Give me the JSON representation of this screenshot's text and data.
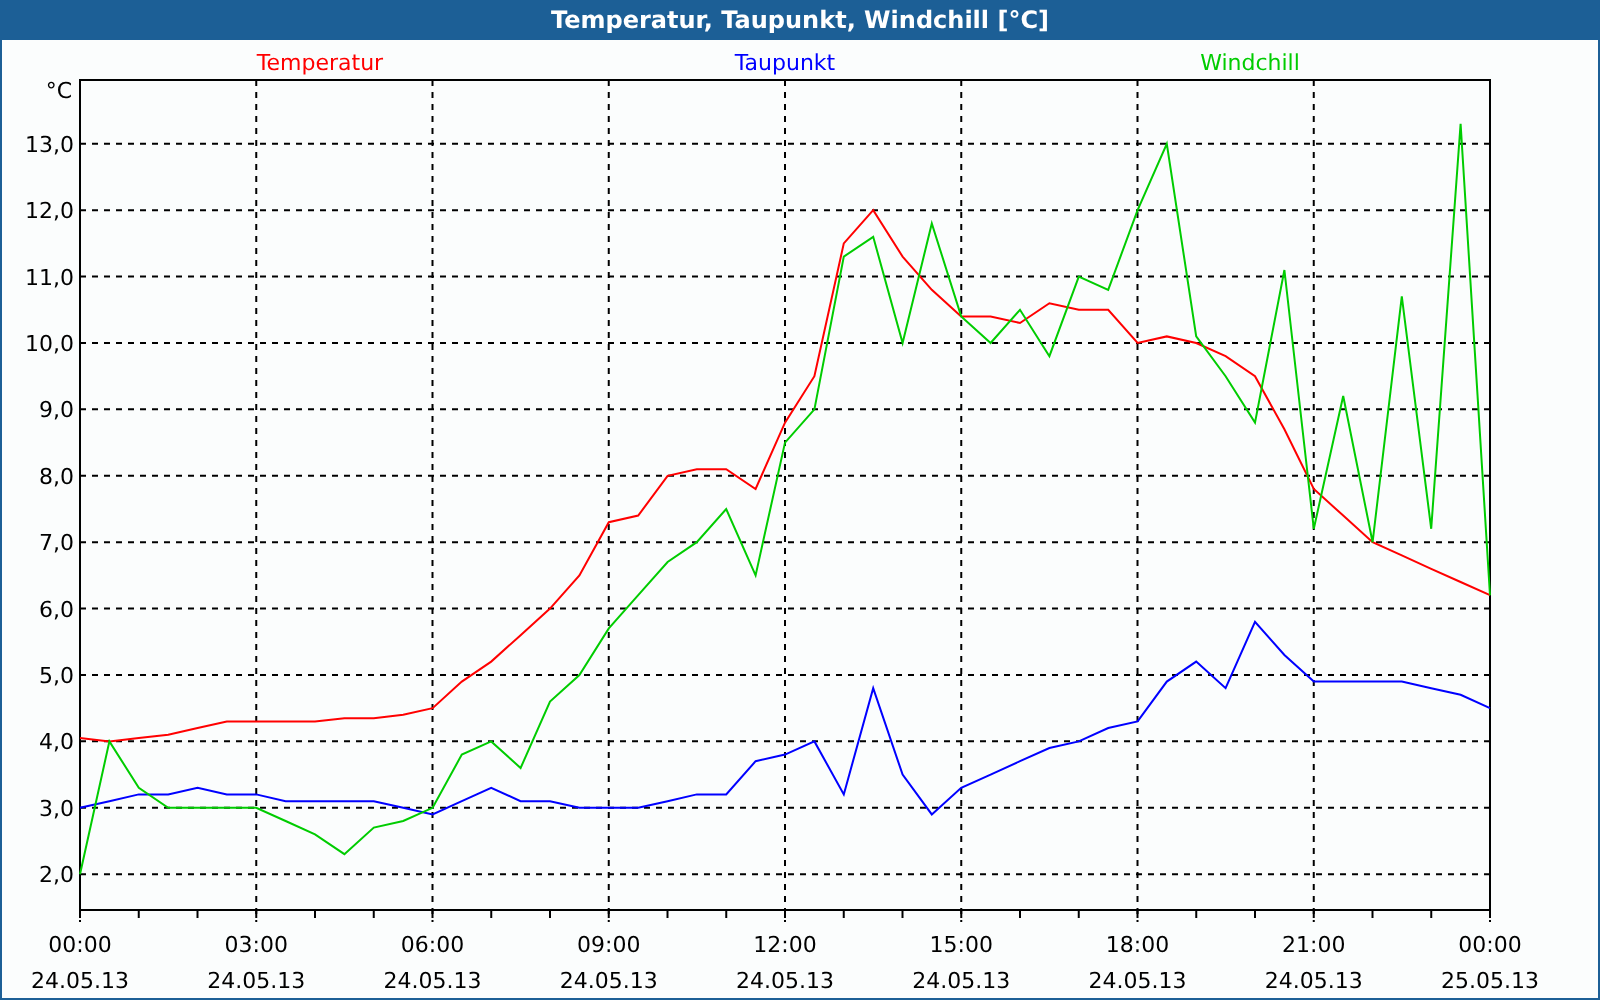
{
  "window": {
    "title": "Temperatur, Taupunkt, Windchill [°C]"
  },
  "chart_data": {
    "type": "line",
    "grid": true,
    "ylabel": "°C",
    "ylim": [
      1.46,
      13.96
    ],
    "categories": [
      "00:00\n24.05.13",
      null,
      null,
      null,
      null,
      null,
      "03:00\n24.05.13",
      null,
      null,
      null,
      null,
      null,
      "06:00\n24.05.13",
      null,
      null,
      null,
      null,
      null,
      "09:00\n24.05.13",
      null,
      null,
      null,
      null,
      null,
      "12:00\n24.05.13",
      null,
      null,
      null,
      null,
      null,
      "15:00\n24.05.13",
      null,
      null,
      null,
      null,
      null,
      "18:00\n24.05.13",
      null,
      null,
      null,
      null,
      null,
      "21:00\n24.05.13",
      null,
      null,
      null,
      null,
      null,
      "00:00\n25.05.13"
    ],
    "yticks": [
      {
        "value": 2,
        "label": "2,0"
      },
      {
        "value": 3,
        "label": "3,0"
      },
      {
        "value": 4,
        "label": "4,0"
      },
      {
        "value": 5,
        "label": "5,0"
      },
      {
        "value": 6,
        "label": "6,0"
      },
      {
        "value": 7,
        "label": "7,0"
      },
      {
        "value": 8,
        "label": "8,0"
      },
      {
        "value": 9,
        "label": "9,0"
      },
      {
        "value": 10,
        "label": "10,0"
      },
      {
        "value": 11,
        "label": "11,0"
      },
      {
        "value": 12,
        "label": "12,0"
      },
      {
        "value": 13,
        "label": "13,0"
      }
    ],
    "series": [
      {
        "name": "Temperatur",
        "color": "#ff0000",
        "values": [
          4.05,
          4.0,
          4.05,
          4.1,
          4.2,
          4.3,
          4.3,
          4.3,
          4.3,
          4.35,
          4.35,
          4.4,
          4.5,
          4.9,
          5.2,
          5.6,
          6.0,
          6.5,
          7.3,
          7.4,
          8.0,
          8.1,
          8.1,
          7.8,
          8.8,
          9.5,
          11.5,
          12.0,
          11.3,
          10.8,
          10.4,
          10.4,
          10.3,
          10.6,
          10.5,
          10.5,
          10.0,
          10.1,
          10.0,
          9.8,
          9.5,
          8.7,
          7.8,
          7.4,
          7.0,
          6.8,
          6.6,
          6.4,
          6.2
        ]
      },
      {
        "name": "Taupunkt",
        "color": "#0000ff",
        "values": [
          3.0,
          3.1,
          3.2,
          3.2,
          3.3,
          3.2,
          3.2,
          3.1,
          3.1,
          3.1,
          3.1,
          3.0,
          2.9,
          3.1,
          3.3,
          3.1,
          3.1,
          3.0,
          3.0,
          3.0,
          3.1,
          3.2,
          3.2,
          3.7,
          3.8,
          4.0,
          3.2,
          4.8,
          3.5,
          2.9,
          3.3,
          3.5,
          3.7,
          3.9,
          4.0,
          4.2,
          4.3,
          4.9,
          5.2,
          4.8,
          5.8,
          5.3,
          4.9,
          4.9,
          4.9,
          4.9,
          4.8,
          4.7,
          4.5
        ]
      },
      {
        "name": "Windchill",
        "color": "#00cc00",
        "values": [
          2.0,
          4.0,
          3.3,
          3.0,
          3.0,
          3.0,
          3.0,
          2.8,
          2.6,
          2.3,
          2.7,
          2.8,
          3.0,
          3.8,
          4.0,
          3.6,
          4.6,
          5.0,
          5.7,
          6.2,
          6.7,
          7.0,
          7.5,
          6.5,
          8.5,
          9.0,
          11.3,
          11.6,
          10.0,
          11.8,
          10.4,
          10.0,
          10.5,
          9.8,
          11.0,
          10.8,
          12.0,
          13.0,
          10.1,
          9.5,
          8.8,
          11.1,
          7.2,
          9.2,
          7.0,
          10.7,
          7.2,
          13.3,
          6.2
        ]
      }
    ]
  }
}
